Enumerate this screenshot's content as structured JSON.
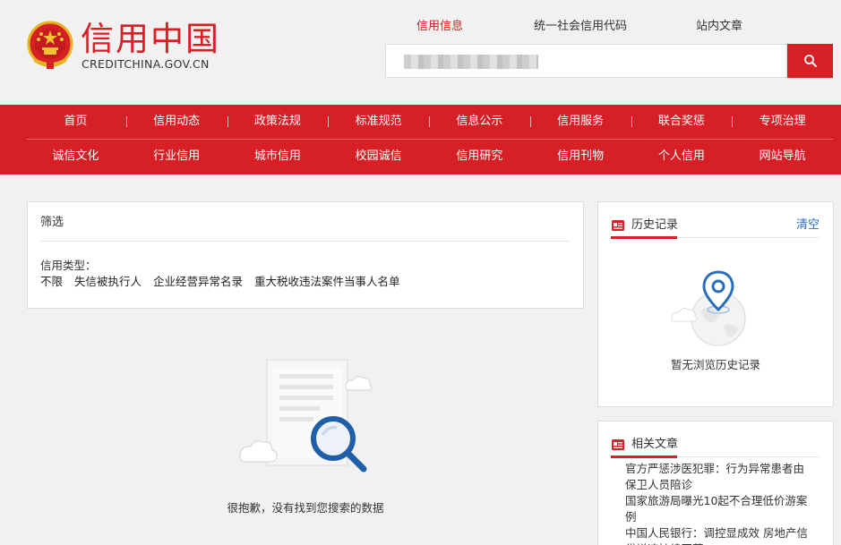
{
  "logo": {
    "title": "信用中国",
    "subtitle": "CREDITCHINA.GOV.CN"
  },
  "search": {
    "tabs": [
      {
        "label": "信用信息",
        "active": true
      },
      {
        "label": "统一社会信用代码",
        "active": false
      },
      {
        "label": "站内文章",
        "active": false
      }
    ],
    "button_icon": "search-icon"
  },
  "nav": {
    "row1": [
      "首页",
      "信用动态",
      "政策法规",
      "标准规范",
      "信息公示",
      "信用服务",
      "联合奖惩",
      "专项治理"
    ],
    "row2": [
      "诚信文化",
      "行业信用",
      "城市信用",
      "校园诚信",
      "信用研究",
      "信用刊物",
      "个人信用",
      "网站导航"
    ]
  },
  "filter": {
    "title": "筛选",
    "type_label": "信用类型：",
    "options": [
      "不限",
      "失信被执行人",
      "企业经营异常名录",
      "重大税收违法案件当事人名单"
    ]
  },
  "empty": {
    "message": "很抱歉，没有找到您搜索的数据"
  },
  "history": {
    "title": "历史记录",
    "clear": "清空",
    "empty": "暂无浏览历史记录"
  },
  "related": {
    "title": "相关文章",
    "items": [
      "官方严惩涉医犯罪：行为异常患者由保卫人员陪诊",
      "国家旅游局曝光10起不合理低价游案例",
      "中国人民银行：调控显成效 房地产信贷增速持续回落"
    ]
  },
  "colors": {
    "brand_red": "#d71f26",
    "link_blue": "#2a6fb9",
    "background": "#f1f1f1"
  }
}
